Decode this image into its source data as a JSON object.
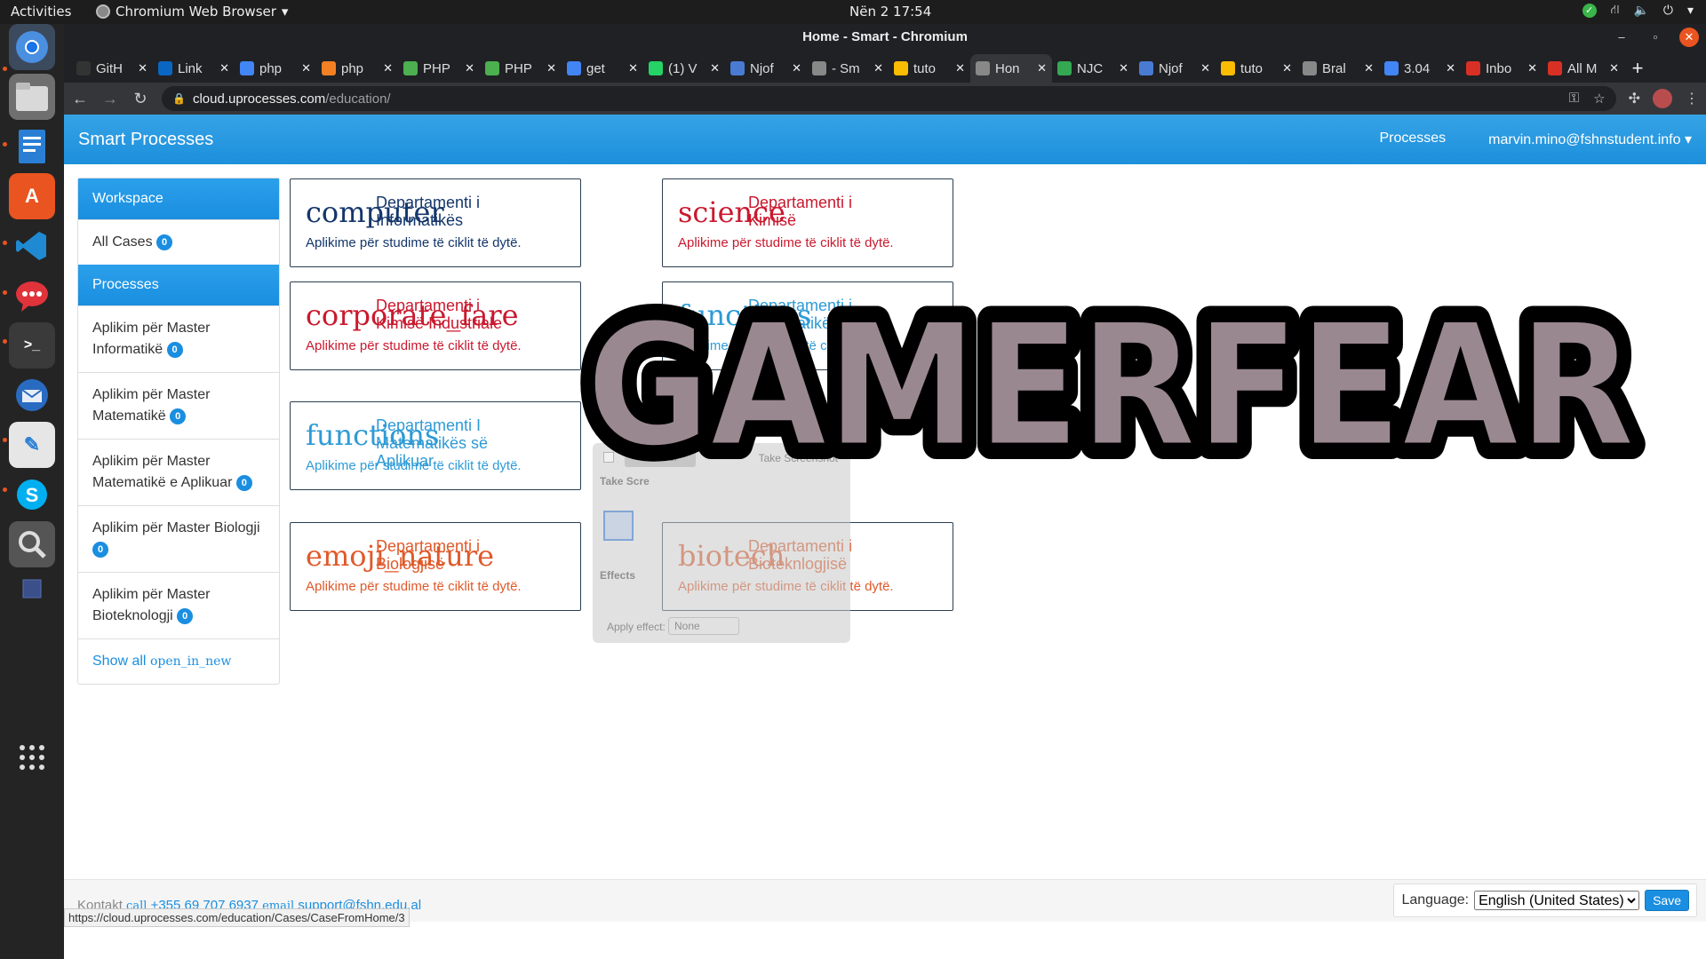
{
  "topbar": {
    "activities": "Activities",
    "app_name": "Chromium Web Browser",
    "clock": "Nën 2  17:54"
  },
  "window": {
    "title": "Home - Smart - Chromium"
  },
  "tabs": [
    {
      "title": "GitH",
      "color": "#333333"
    },
    {
      "title": "Link",
      "color": "#0a66c2"
    },
    {
      "title": "php",
      "color": "#4285f4"
    },
    {
      "title": "php",
      "color": "#f48024"
    },
    {
      "title": "PHP",
      "color": "#4caf50"
    },
    {
      "title": "PHP",
      "color": "#4caf50"
    },
    {
      "title": "get",
      "color": "#4285f4"
    },
    {
      "title": "(1) V",
      "color": "#25d366"
    },
    {
      "title": "Njof",
      "color": "#4a7bd3"
    },
    {
      "title": "- Sm",
      "color": "#888888"
    },
    {
      "title": "tuto",
      "color": "#fbbc04"
    },
    {
      "title": "Hon",
      "color": "#888888",
      "active": true
    },
    {
      "title": "NJC",
      "color": "#34a853"
    },
    {
      "title": "Njof",
      "color": "#4a7bd3"
    },
    {
      "title": "tuto",
      "color": "#fbbc04"
    },
    {
      "title": "Bral",
      "color": "#888888"
    },
    {
      "title": "3.04",
      "color": "#4285f4"
    },
    {
      "title": "Inbo",
      "color": "#d93025"
    },
    {
      "title": "All M",
      "color": "#d93025"
    }
  ],
  "address": {
    "domain": "cloud.uprocesses.com",
    "path": "/education/"
  },
  "app": {
    "brand": "Smart Processes",
    "nav_processes": "Processes",
    "user_email": "marvin.mino@fshnstudent.info ▾"
  },
  "sidebar": {
    "workspace": "Workspace",
    "all_cases": "All Cases",
    "all_cases_count": "0",
    "processes": "Processes",
    "items": [
      {
        "label": "Aplikim për Master Informatikë",
        "count": "0"
      },
      {
        "label": "Aplikim për Master Matematikë",
        "count": "0"
      },
      {
        "label": "Aplikim për Master Matematikë e Aplikuar",
        "count": "0"
      },
      {
        "label": "Aplikim për Master Biologji",
        "count": "0"
      },
      {
        "label": "Aplikim për Master Bioteknologji",
        "count": "0"
      }
    ],
    "show_all": "Show all",
    "show_all_icon": "open_in_new"
  },
  "cards": [
    {
      "icon_text": "computer",
      "dept": "Departamenti i Informatikës",
      "subtitle": "Aplikime për studime të ciklit të dytë.",
      "color": "#14366b"
    },
    {
      "icon_text": "science",
      "dept": "Departamenti i Kimisë",
      "subtitle": "Aplikime për studime të ciklit të dytë.",
      "color": "#c9192e"
    },
    {
      "icon_text": "corporate_fare",
      "dept": "Departamenti i Kimisë Industriale",
      "subtitle": "Aplikime për studime të ciklit të dytë.",
      "color": "#c9192e"
    },
    {
      "icon_text": "functions",
      "dept": "Departamenti i Matematikës",
      "subtitle": "Aplikime për studime të ciklit të dytë.",
      "color": "#2e9bd6"
    },
    {
      "icon_text": "functions",
      "dept": "Departamenti I Matematikës së Aplikuar",
      "subtitle": "Aplikime për studime të ciklit të dytë.",
      "color": "#2e9bd6"
    },
    {
      "icon_text": "emoji_nature",
      "dept": "Departamenti i Biologjisë",
      "subtitle": "Aplikime për studime të ciklit të dytë.",
      "color": "#e0592a"
    },
    {
      "icon_text": "biotech",
      "dept": "Departamenti i Bioteknlogjisë",
      "subtitle": "Aplikime për studime të ciklit të dytë.",
      "color": "#e0592a"
    }
  ],
  "footer": {
    "contact_label": "Kontakt",
    "call_icon": "call",
    "phone": "+355 69 707 6937",
    "email_icon": "email",
    "email": "support@fshn.edu.al",
    "language_label": "Language:",
    "language_value": "English (United States)",
    "save": "Save"
  },
  "status_url": "https://cloud.uprocesses.com/education/Cases/CaseFromHome/3",
  "screenshot_dialog": {
    "cancel": "Cancel",
    "take": "Take Screenshot",
    "take_label": "Take Scre",
    "effects": "Effects",
    "apply_effect": "Apply effect:",
    "effect_value": "None"
  },
  "watermark": {
    "text": "GAMERFEAR"
  }
}
